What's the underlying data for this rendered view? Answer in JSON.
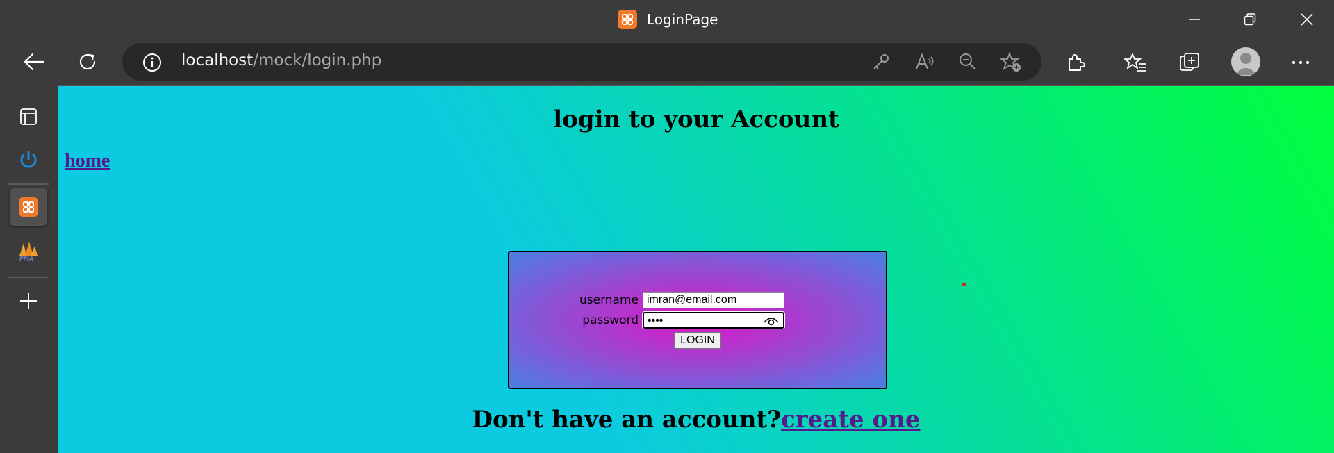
{
  "window": {
    "title": "LoginPage",
    "icon": "xampp-icon"
  },
  "address_bar": {
    "host": "localhost",
    "path": "/mock/login.php"
  },
  "sidebar": {
    "items": [
      {
        "name": "tab-actions-icon"
      },
      {
        "name": "power-icon"
      },
      {
        "name": "xampp-icon"
      },
      {
        "name": "phpmyadmin-icon"
      },
      {
        "name": "add-icon"
      }
    ]
  },
  "page": {
    "heading": "login to your Account",
    "home_link": "home",
    "form": {
      "username_label": "username",
      "username_value": "imran@email.com",
      "password_label": "password",
      "password_value": "••••",
      "login_button": "LOGIN"
    },
    "signup_text": "Don't have an account?",
    "signup_link": "create one"
  },
  "colors": {
    "link": "#551a8b",
    "gradient_start": "#0ccbe0",
    "gradient_end": "#00ff3c",
    "box_center": "#d816c8",
    "box_edge": "#4a80e0"
  }
}
